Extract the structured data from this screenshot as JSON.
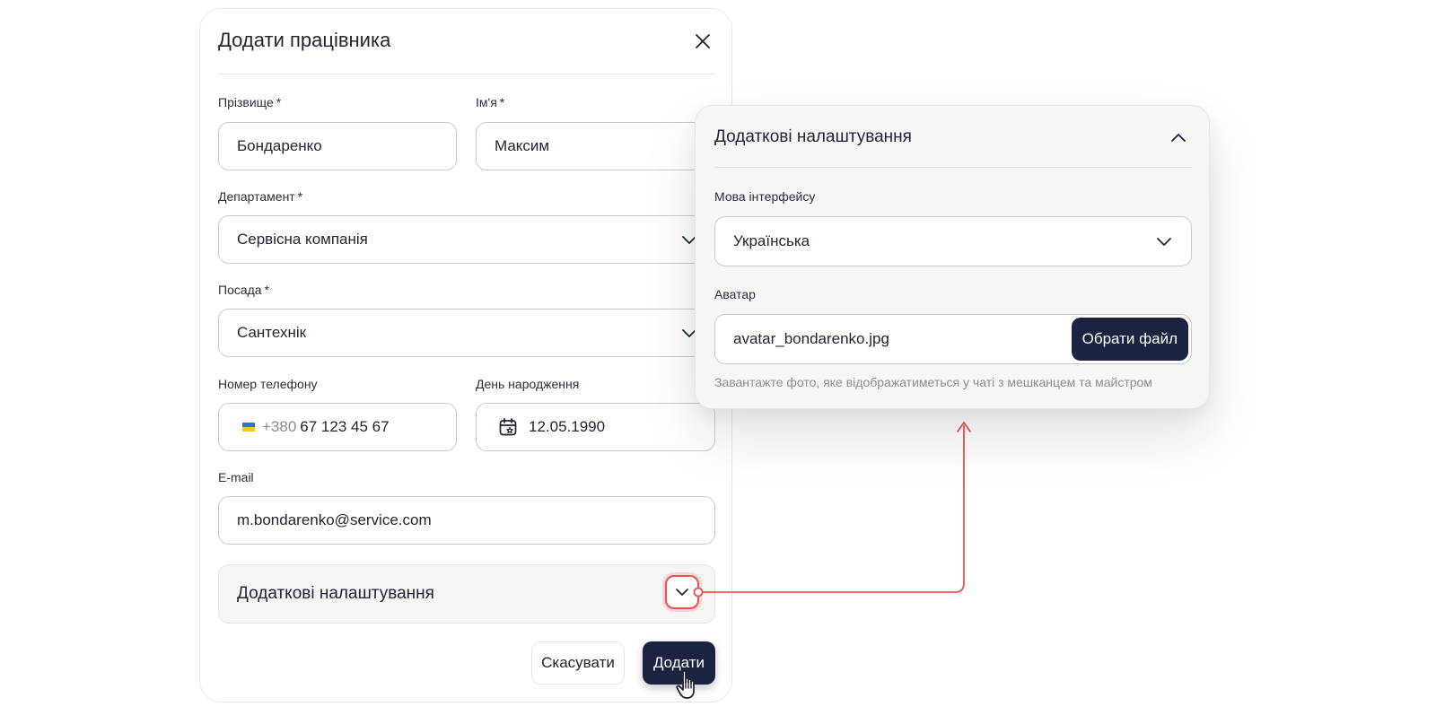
{
  "modal": {
    "title": "Додати працівника",
    "last_name": {
      "label": "Прізвище",
      "required_mark": "*",
      "value": "Бондаренко"
    },
    "first_name": {
      "label": "Ім'я",
      "required_mark": "*",
      "value": "Максим"
    },
    "department": {
      "label": "Департамент",
      "required_mark": "*",
      "value": "Сервісна компанія"
    },
    "position": {
      "label": "Посада",
      "required_mark": "*",
      "value": "Сантехнік"
    },
    "phone": {
      "label": "Номер телефону",
      "country_code": "+380",
      "value": "67 123 45 67"
    },
    "birthday": {
      "label": "День народження",
      "value": "12.05.1990"
    },
    "email": {
      "label": "E-mail",
      "value": "m.bondarenko@service.com"
    },
    "advanced_settings_label": "Додаткові налаштування",
    "cancel_label": "Скасувати",
    "add_label": "Додати"
  },
  "panel": {
    "title": "Додаткові налаштування",
    "language": {
      "label": "Мова інтерфейсу",
      "value": "Українська"
    },
    "avatar": {
      "label": "Аватар",
      "file_name": "avatar_bondarenko.jpg",
      "button_label": "Обрати файл"
    },
    "hint": "Завантажте фото, яке відображатиметься у чаті з мешканцем та майстром"
  },
  "colors": {
    "primary_dark": "#1c2340",
    "highlight": "#f05050",
    "border": "#c9cbd1"
  },
  "icons": [
    "close-icon",
    "chevron-down-icon",
    "chevron-up-icon",
    "calendar-icon",
    "ukraine-flag-icon",
    "hand-cursor-icon"
  ]
}
